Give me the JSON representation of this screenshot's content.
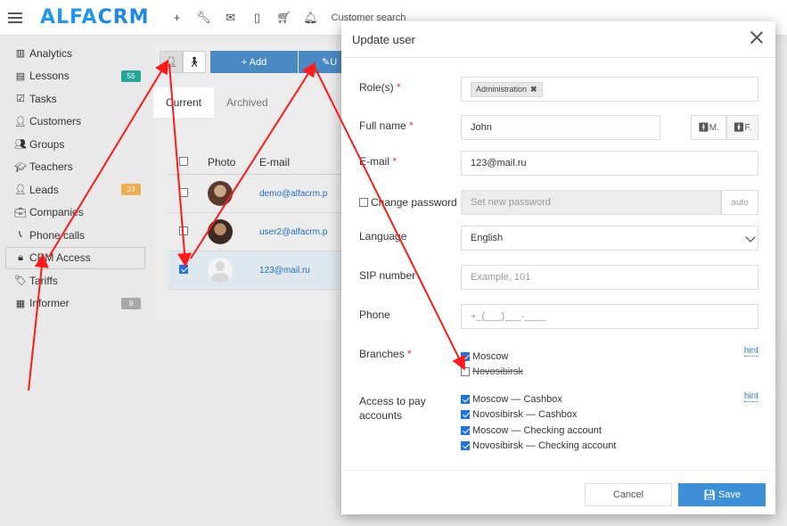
{
  "app": {
    "logo_part1": "ALFA",
    "logo_part2": "CRM",
    "search_placeholder": "Customer search"
  },
  "topbar_icons": [
    "plus-icon",
    "wrench-icon",
    "mail-icon",
    "mobile-icon",
    "cart-icon",
    "bell-icon"
  ],
  "sidebar": {
    "items": [
      {
        "label": "Analytics",
        "icon": "chart-icon"
      },
      {
        "label": "Lessons",
        "icon": "calendar-icon",
        "badge": "55"
      },
      {
        "label": "Tasks",
        "icon": "tasks-icon"
      },
      {
        "label": "Customers",
        "icon": "user-icon"
      },
      {
        "label": "Groups",
        "icon": "users-icon"
      },
      {
        "label": "Teachers",
        "icon": "graduation-cap-icon"
      },
      {
        "label": "Leads",
        "icon": "user-plus-icon",
        "badge": "23"
      },
      {
        "label": "Companies",
        "icon": "briefcase-icon"
      },
      {
        "label": "Phone calls",
        "icon": "phone-icon"
      },
      {
        "label": "CRM Access",
        "icon": "lock-icon",
        "active": true
      },
      {
        "label": "Tariffs",
        "icon": "tag-icon"
      },
      {
        "label": "Informer",
        "icon": "newspaper-icon",
        "badge": "9"
      }
    ]
  },
  "content": {
    "add_button": "+ Add",
    "edit_button_partial": "U",
    "tabs": [
      "Current",
      "Archived"
    ],
    "columns": [
      "Photo",
      "E-mail"
    ],
    "rows": [
      {
        "email": "demo@alfacrm.p",
        "checked": false
      },
      {
        "email": "user2@alfacrm.p",
        "checked": false
      },
      {
        "email": "123@mail.ru",
        "checked": true
      }
    ]
  },
  "modal": {
    "title": "Update user",
    "roles_label": "Role(s)",
    "role_tag": "Administration",
    "fullname_label": "Full name",
    "fullname_value": "John",
    "gender_male": "M.",
    "gender_female": "F.",
    "email_label": "E-mail",
    "email_value": "123@mail.ru",
    "change_password_label": "Change password",
    "password_placeholder": "Set new password",
    "auto_button": "auto",
    "language_label": "Language",
    "language_value": "English",
    "sip_label": "SIP number",
    "sip_placeholder": "Example, 101",
    "phone_label": "Phone",
    "phone_placeholder": "+_(___)___-____",
    "branches_label": "Branches",
    "branches": [
      {
        "label": "Moscow",
        "checked": true
      },
      {
        "label": "Novosibirsk",
        "checked": false
      }
    ],
    "hint": "hint",
    "pay_accounts_label_1": "Access to pay",
    "pay_accounts_label_2": "accounts",
    "pay_accounts": [
      {
        "label": "Moscow — Cashbox",
        "checked": true
      },
      {
        "label": "Novosibirsk — Cashbox",
        "checked": true
      },
      {
        "label": "Moscow — Checking account",
        "checked": true
      },
      {
        "label": "Novosibirsk — Checking account",
        "checked": true
      }
    ],
    "cancel_button": "Cancel",
    "save_button": "Save"
  },
  "colors": {
    "brand_blue": "#2196f3",
    "primary_button": "#3d8fd8",
    "annotation_arrow": "#ff1a1a",
    "required_star": "#e53935"
  }
}
